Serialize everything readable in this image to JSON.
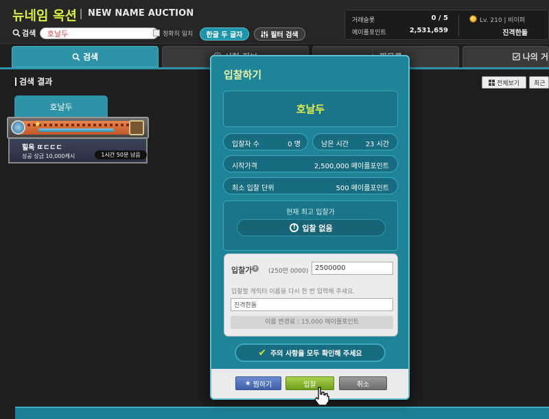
{
  "header": {
    "title": "뉴네임 옥션",
    "subtitle": "NEW NAME AUCTION",
    "search_label": "검색",
    "search_value": "호날두",
    "exact_match_label": "정확히 일치",
    "korean_two_chars_label": "한글 두 글자",
    "filter_search_label": "필터 검색"
  },
  "stats": {
    "trade_slot_label": "거래슬롯",
    "trade_slot_value": "0 / 5",
    "maple_points_label": "메이플포인트",
    "maple_points_value": "2,531,659",
    "level_text": "Lv. 210 | 비이퍼",
    "character_name": "진격한돌"
  },
  "tabs": [
    {
      "label": "검색",
      "icon": "search-icon",
      "active": true
    },
    {
      "label": "시청 정보",
      "icon": "info-icon",
      "active": false
    },
    {
      "label": "찜목록",
      "icon": "star-icon",
      "active": false
    },
    {
      "label": "나의 거",
      "icon": "check-square-icon",
      "active": false
    }
  ],
  "results": {
    "heading": "검색 결과",
    "view_all_label": "전체보기",
    "recent_label": "최근",
    "result_tab_name": "호날두",
    "card": {
      "name": "힐옥 ㄸㄷㄷㄷ",
      "bonus_text": "성공 상금 10,000캐시",
      "time_left": "1시간 50분 남음"
    }
  },
  "modal": {
    "title": "입찰하기",
    "item_name": "호날두",
    "bidders_label": "입찰자 수",
    "bidders_value": "0  명",
    "time_left_label": "남은 시간",
    "time_left_value": "23 시간",
    "start_price_label": "시작가격",
    "start_price_value": "2,500,000   메이플포인트",
    "min_increment_label": "최소 입찰 단위",
    "min_increment_value": "500   메이플포인트",
    "highest_bid_label": "현재 최고 입찰가",
    "highest_bid_value": "입찰 없음",
    "bid_label": "입찰가",
    "bid_hint": "(250만 0000)",
    "bid_value": "2500000",
    "name_prompt": "입찰할 캐릭터 이름을 다시 한 번 입력해 주세요.",
    "name_input_value": "진격한돌",
    "fee_text": "이름 변경료 : 15,000 메이플포인트",
    "confirm_text": "주의 사항을 모두 확인해 주세요",
    "favorite_button": "찜하기",
    "bid_button": "입찰",
    "cancel_button": "취소"
  },
  "colors": {
    "accent_teal": "#1e8599",
    "title_yellow": "#dcee3f",
    "name_yellow": "#e4f24c",
    "bid_green": "#8cba33"
  }
}
